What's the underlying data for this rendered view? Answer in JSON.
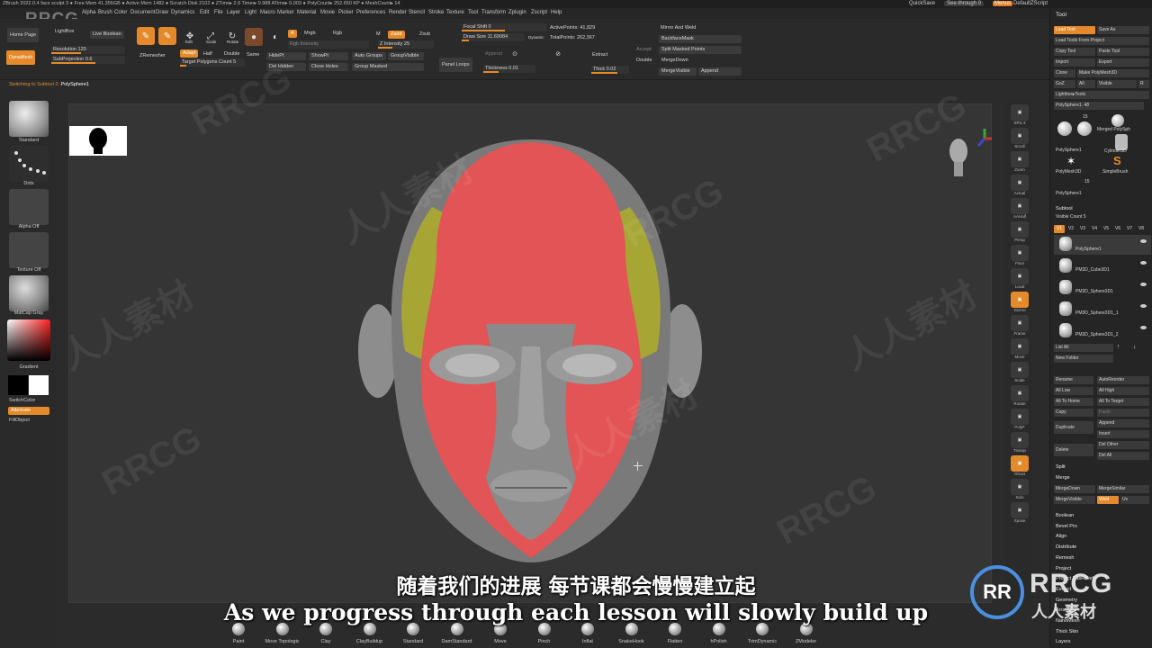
{
  "title_bar": "ZBrush 2022.0.4   face sculpt 3   ● Free Mem 41.355GB ● Active Mem 1482 ● Scratch Disk 2102 ● ZTime▸ 2.9 Timer▸ 0.988 ATime▸ 0.003 ● PolyCount▸ 252.650 KP ● MeshCount▸ 14",
  "menu": [
    "Alpha",
    "Brush",
    "Color",
    "Document",
    "Draw",
    "Dynamics",
    "Edit",
    "File",
    "Layer",
    "Light",
    "Macro",
    "Marker",
    "Material",
    "Movie",
    "Picker",
    "Preferences",
    "Render",
    "Stencil",
    "Stroke",
    "Texture",
    "Tool",
    "Transform",
    "Zplugin",
    "Zscript",
    "Help"
  ],
  "quick": {
    "quicksave": "QuickSave",
    "seethrough": "See-through  0",
    "menus": "Menus",
    "script": "DefaultZScript"
  },
  "shelf": {
    "home_page": "Home Page",
    "lightbox": "LightBox",
    "live_boolean": "Live Boolean",
    "dynamesh": "DynaMesh",
    "resolution": "Resolution 120",
    "subprojection": "SubProjection 0.6",
    "zremesher": "ZRemesher",
    "adapt": "Adapt",
    "half": "Half",
    "double": "Double",
    "same": "Same",
    "target_poly": "Target Polygons Count 5",
    "edit": "Edit",
    "draw": "Draw",
    "move": "Move",
    "scale": "Scale",
    "rotate": "Rotate",
    "a": "A",
    "mrgb": "Mrgb",
    "rgb": "Rgb",
    "m": "M",
    "zadd": "Zadd",
    "zsub": "Zsub",
    "rgb_intensity": "Rgb Intensity",
    "z_intensity": "Z Intensity 25",
    "hidept": "HidePt",
    "del_hidden": "Del Hidden",
    "showpt": "ShowPt",
    "close_holes": "Close Holes",
    "auto_groups": "Auto Groups",
    "group_visible": "GroupVisible",
    "group_masked": "Group Masked",
    "panel_loops": "Panel Loops",
    "append": "Append",
    "thickness": "Thickness 0.01",
    "focal_shift": "Focal Shift 0",
    "draw_size": "Draw Size 11.69084",
    "dynamic": "Dynamic",
    "active_points": "ActivePoints: 41,829",
    "total_points": "TotalPoints: 262,367",
    "extract": "Extract",
    "accept": "Accept",
    "thick": "Thick 0.02",
    "double2": "Double",
    "mirror_weld": "Mirror And Weld",
    "backface_mask": "BackfaceMask",
    "split_masked": "Split Masked Points",
    "merge_down": "MergeDown",
    "merge_visible": "MergeVisible",
    "append2": "Append"
  },
  "status": {
    "prefix": "Switching to Subtool 2:",
    "name": "PolySphere1"
  },
  "left": {
    "brush": "Standard",
    "stroke": "Dots",
    "alpha": "Alpha Off",
    "texture": "Texture Off",
    "material": "MatCap Gray",
    "gradient": "Gradient",
    "switch_color": "SwitchColor",
    "alternate": "Alternate",
    "fillobject": "FillObject"
  },
  "right": [
    "SPix 3",
    "Scroll",
    "Zoom",
    "Actual",
    "AAHalf",
    "Persp",
    "Floor",
    "Local",
    "Gizmo",
    "Frame",
    "Move",
    "Scale",
    "Rotate",
    "PolyF",
    "Transp",
    "Ghost",
    "Solo",
    "Xpose"
  ],
  "tool": {
    "title": "Tool",
    "buttons": [
      "Load Tool",
      "Save As",
      "Load Tools From Project",
      "Copy Tool",
      "Paste Tool",
      "Import",
      "Export",
      "Clone",
      "Make PolyMesh3D",
      "GoZ",
      "All",
      "Visible",
      "R",
      "Lightbox▸Tools"
    ],
    "current": "PolySphere1. 48",
    "thumbs": [
      "PolySphere1",
      "Merged PolySph",
      "PolySphere1",
      "Cylinder3D",
      "PolyMesh3D",
      "SimpleBrush",
      "PolySphere1"
    ],
    "counts": [
      "15",
      "15"
    ],
    "subtool_title": "Subtool",
    "visible_count": "Visible Count 5",
    "versions": [
      "V1",
      "V2",
      "V3",
      "V4",
      "V5",
      "V6",
      "V7",
      "V8"
    ],
    "subtools": [
      "PolySphere1",
      "PM3D_Cube3D1",
      "PM3D_Sphere3D1",
      "PM3D_Sphere3D1_1",
      "PM3D_Sphere3D1_2"
    ],
    "list_all": "List All",
    "new_folder": "New Folder",
    "rename": "Rename",
    "autoreorder": "AutoReorder",
    "all_low": "All Low",
    "all_high": "All High",
    "all_to_home": "All To Home",
    "all_to_target": "All To Target",
    "copy": "Copy",
    "paste": "Paste",
    "duplicate": "Duplicate",
    "append": "Append",
    "insert": "Insert",
    "delete": "Delete",
    "del_other": "Del Other",
    "del_all": "Del All",
    "split": "Split",
    "merge": "Merge",
    "merge_down": "MergeDown",
    "merge_similar": "MergeSimilar",
    "merge_visible": "MergeVisible",
    "weld": "Weld",
    "uv": "Uv",
    "sections": [
      "Boolean",
      "Bevel Pro",
      "Align",
      "Distribute",
      "Remesh",
      "Project",
      "Project BasRelief",
      "Extract",
      "Geometry",
      "ArrayMesh",
      "NanoMesh",
      "Thick Skin",
      "Layers"
    ]
  },
  "brushes": [
    "Paint",
    "Move Topologic",
    "Clay",
    "ClayBuildup",
    "Standard",
    "DamStandard",
    "Move",
    "Pinch",
    "Inflat",
    "SnakeHook",
    "Flatten",
    "hPolish",
    "TrimDynamic",
    "ZModeler"
  ],
  "subtitle_cn": "随着我们的进展 每节课都会慢慢建立起",
  "subtitle_en": "As we progress through each lesson will slowly build up",
  "watermark": {
    "top": "RRCG",
    "logo_badge": "RR",
    "logo_text": "RRCG",
    "logo_cn": "人人素材",
    "wm_text": "RRCG",
    "wm_cn": "人人素材"
  },
  "colors": {
    "accent": "#e48a2a",
    "mask_red": "#e25455",
    "mask_yellow": "#a7a635",
    "background": "#2b2b2b"
  }
}
